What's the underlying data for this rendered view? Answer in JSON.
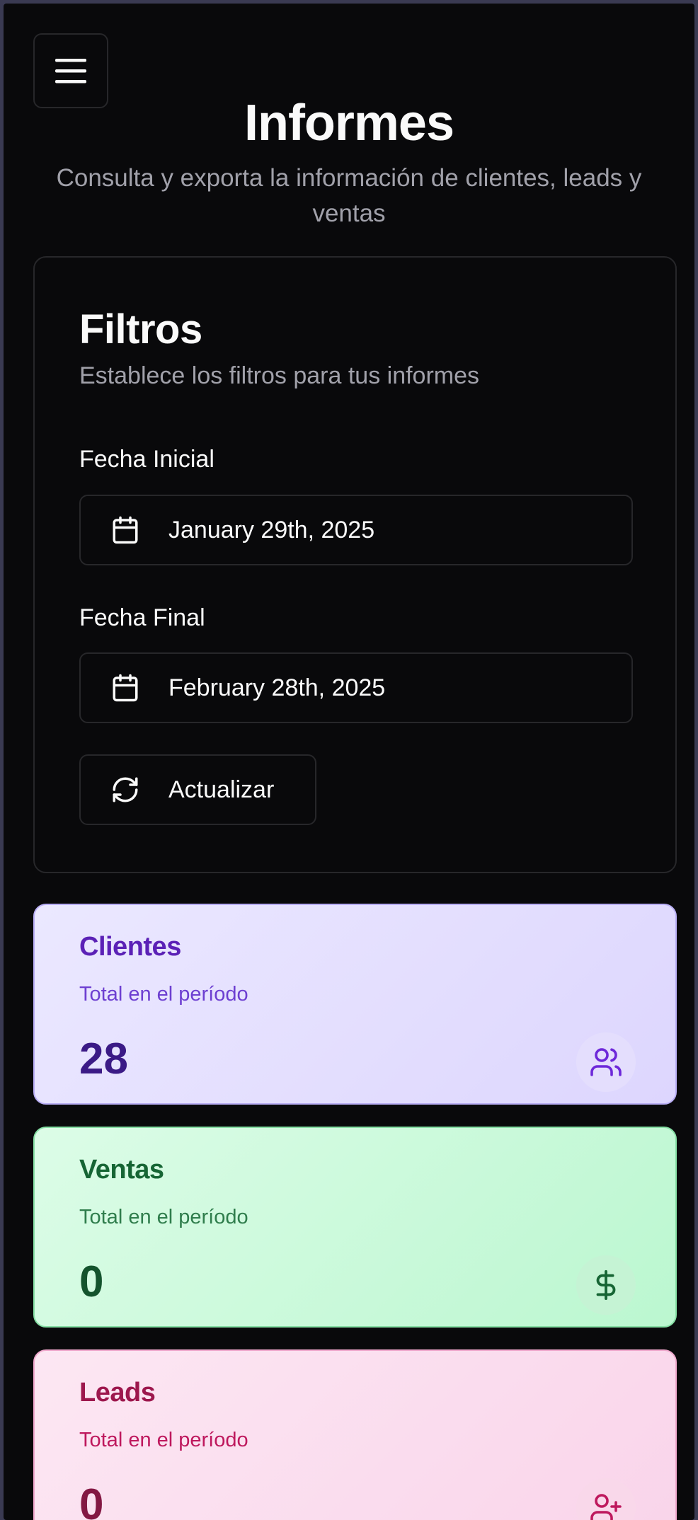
{
  "header": {
    "menu_icon": "hamburger-menu-icon",
    "title": "Informes",
    "subtitle": "Consulta y exporta la información de clientes, leads y ventas"
  },
  "filters": {
    "title": "Filtros",
    "description": "Establece los filtros para tus informes",
    "start_label": "Fecha Inicial",
    "start_value": "January 29th, 2025",
    "end_label": "Fecha Final",
    "end_value": "February 28th, 2025",
    "refresh_label": "Actualizar",
    "calendar_icon": "calendar-icon",
    "refresh_icon": "refresh-icon"
  },
  "stats": {
    "clientes": {
      "title": "Clientes",
      "desc": "Total en el período",
      "value": "28",
      "icon": "users-icon",
      "accent": "#5b21b6"
    },
    "ventas": {
      "title": "Ventas",
      "desc": "Total en el período",
      "value": "0",
      "icon": "dollar-icon",
      "accent": "#166534"
    },
    "leads": {
      "title": "Leads",
      "desc": "Total en el período",
      "value": "0",
      "icon": "user-plus-icon",
      "accent": "#9d174d"
    }
  },
  "colors": {
    "background": "#09090b",
    "border": "#27272a",
    "text": "#fafafa",
    "muted": "#a1a1aa"
  }
}
